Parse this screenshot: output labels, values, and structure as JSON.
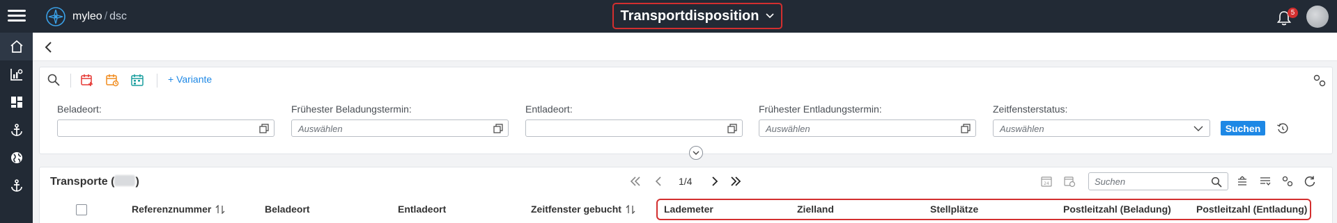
{
  "app": {
    "brand": "myleo",
    "brand_separator": "/",
    "brand_sub": "dsc",
    "title": "Transportdisposition",
    "notification_count": "5"
  },
  "nav": {
    "items": [
      "home-icon",
      "analytics-icon",
      "dashboard-icon",
      "anchor-icon",
      "globe-icon",
      "anchor-icon"
    ]
  },
  "toolbar": {
    "add_variant_label": "+ Variante"
  },
  "filters": {
    "beladeort_label": "Beladeort:",
    "beladeort_value": "",
    "frueh_beladung_label": "Frühester Beladungstermin:",
    "frueh_beladung_placeholder": "Auswählen",
    "entladeort_label": "Entladeort:",
    "entladeort_value": "",
    "frueh_entladung_label": "Frühester Entladungstermin:",
    "frueh_entladung_placeholder": "Auswählen",
    "zeitfensterstatus_label": "Zeitfensterstatus:",
    "zeitfensterstatus_placeholder": "Auswählen",
    "search_button": "Suchen"
  },
  "results": {
    "title_prefix": "Transporte (",
    "title_suffix": ")",
    "page_indicator": "1/4",
    "search_placeholder": "Suchen",
    "columns": [
      "Referenznummer",
      "Beladeort",
      "Entladeort",
      "Zeitfenster gebucht",
      "Lademeter",
      "Zielland",
      "Stellplätze",
      "Postleitzahl (Beladung)",
      "Postleitzahl (Entladung)"
    ],
    "sortable_columns": [
      "Referenznummer",
      "Zeitfenster gebucht"
    ]
  },
  "colors": {
    "topbar": "#222a35",
    "accent": "#1e88e5",
    "highlight": "#d32f2f",
    "cal_red": "#e53935",
    "cal_orange": "#f08c1e",
    "cal_teal": "#1a9e9e"
  }
}
